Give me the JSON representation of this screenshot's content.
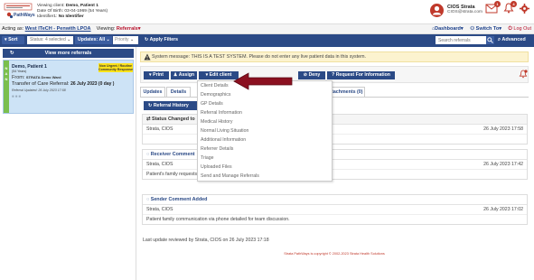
{
  "header": {
    "logo_text": "PathWays",
    "client_line": "Viewing client: ",
    "client_name": "Demo, Patient 1",
    "dob": "Date Of Birth: 03-04-1969 (54 Years)",
    "identifier_label": "Identifier1: ",
    "identifier_value": "No Identifier",
    "user_initial": "S",
    "user_name": "CIOS Strata",
    "user_email": "CIOS@strata.com",
    "mail_badge": "1",
    "bell_badge": "4"
  },
  "nav": {
    "acting_as": "Acting as: ",
    "acting_link": "West ITeCH - Penwith LPOA",
    "viewing_label": "Viewing: ",
    "viewing_value": "Referrals",
    "dashboard": "Dashboard",
    "switch_to": "Switch To",
    "logout": "Log Out"
  },
  "filters": {
    "sort": "Sort",
    "status": "Status: 4 selected",
    "updates": "Updates: All",
    "priority": "Priority",
    "apply": "Apply Filters",
    "search_placeholder": "Search referrals",
    "advanced": "Advanced"
  },
  "sidebar": {
    "view_more": "View more referrals",
    "card": {
      "strip_top": "N",
      "strip_mid": "A",
      "strip_bottom": "N",
      "name": "Demo, Patient 1",
      "years": "(54 Years)",
      "tag": "Non Urgent / Routine Community Response",
      "from_label": "From: ",
      "from_value": "STRATA Demo Ward",
      "transfer_label": "Transfer of Care Referral: ",
      "transfer_date": "26 July 2023 (0 day )",
      "updated": "Referral Updated: 26 July 2023 17:58",
      "icons": "■ ■  ■"
    }
  },
  "main": {
    "system_message": "System message: THIS IS A TEST SYSTEM. Please do not enter any live patient data in this system.",
    "actions": {
      "print": "Print",
      "assign": "Assign",
      "edit_client": "Edit client",
      "deny": "Deny",
      "request_info": "Request For Information"
    },
    "tabs": {
      "updates": "Updates",
      "details": "Details",
      "attachments": "Attachments (0)"
    },
    "referral_history": "Referral History",
    "panels": [
      {
        "title": "Status Changed to",
        "author": "Strata, CIOS",
        "date": "26 July 2023 17:58"
      },
      {
        "title": "Receiver Comment",
        "author": "Strata, CIOS",
        "date": "26 July 2023 17:42",
        "text": "Patient's family requests have been reviewed."
      },
      {
        "title": "Sender Comment Added",
        "author": "Strata, CIOS",
        "date": "26 July 2023 17:02",
        "text": "Patient family communication via phone detailed for team discussion."
      }
    ],
    "last_review": "Last update reviewed by Strata, CIOS on 26 July 2023 17:18",
    "footer": "Strata PathWays is copyright © 2002-2023 Strata Health Solutions"
  },
  "edit_menu": {
    "items": [
      "Client Details",
      "Demographics",
      "GP Details",
      "Referral Information",
      "Medical History",
      "Normal Living Situation",
      "Additional Information",
      "Referrer Details",
      "Triage",
      "Uploaded Files",
      "Send and Manage Referrals"
    ]
  },
  "colors": {
    "primary": "#2b4a86",
    "accent_red": "#b8112b",
    "card_bg": "#cde3f6",
    "strip_green": "#7bbf4e",
    "tag_yellow": "#ffe31a",
    "arrow": "#8b1020"
  }
}
